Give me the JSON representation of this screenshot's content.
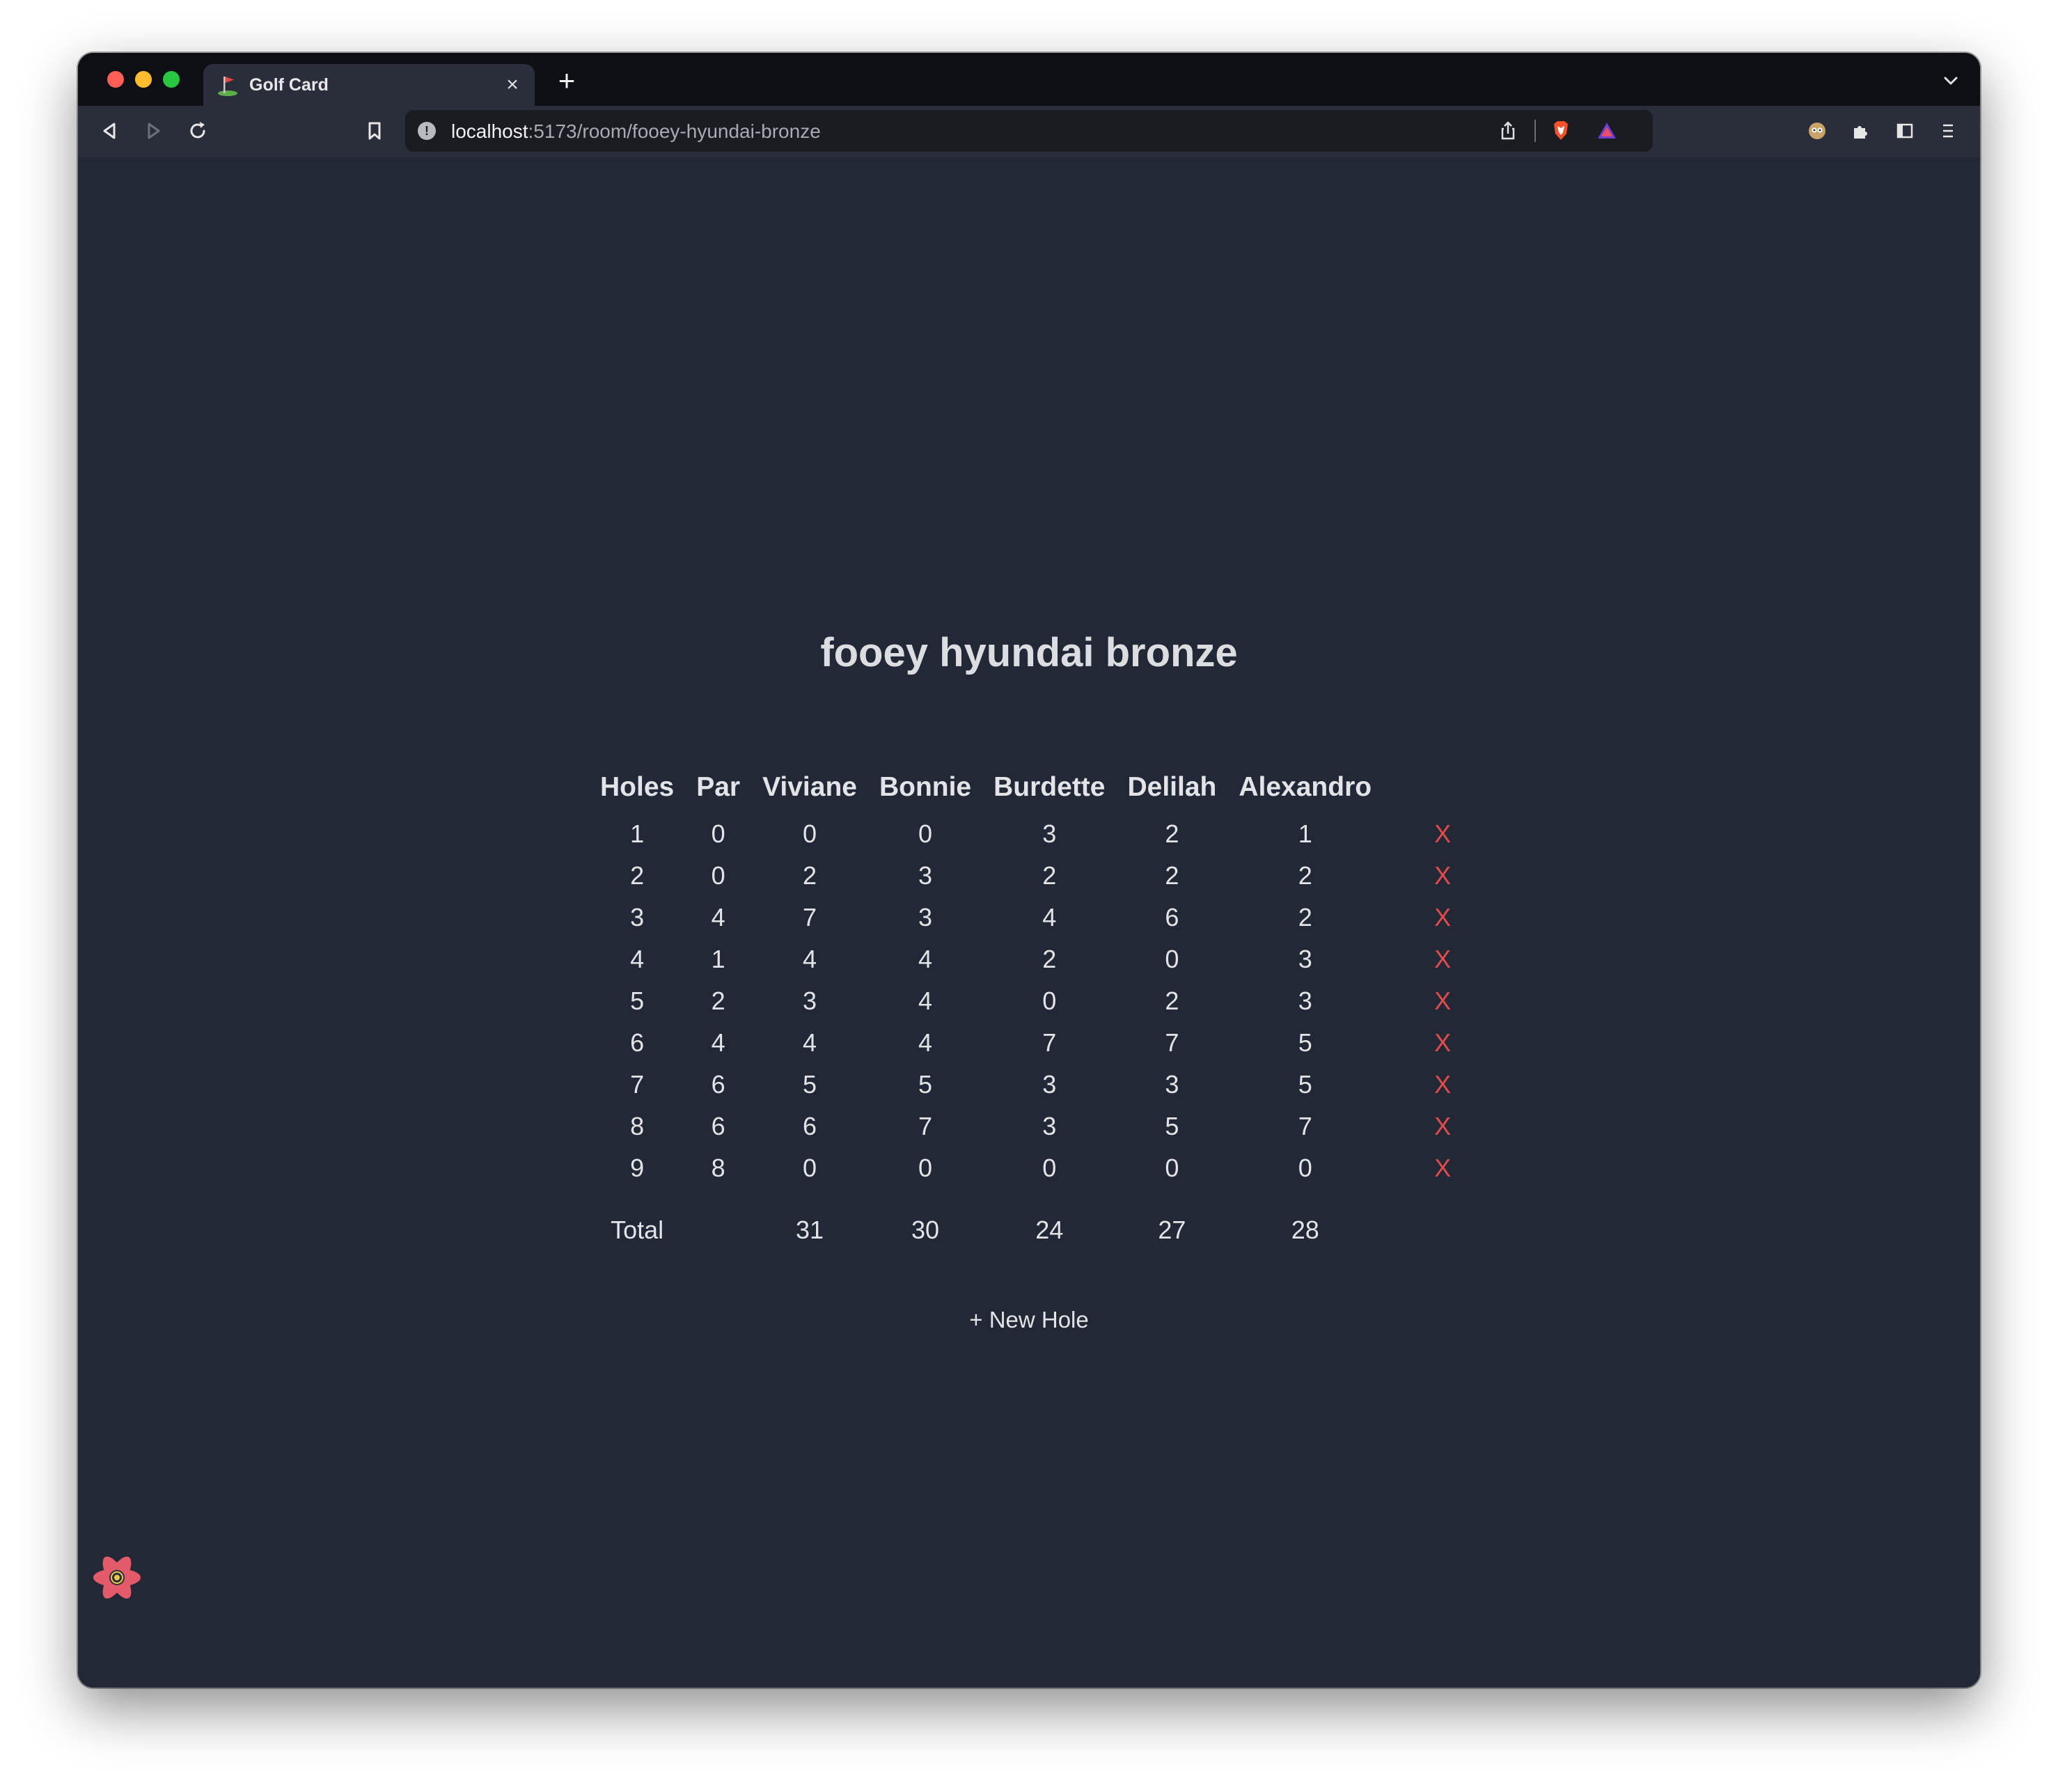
{
  "browser": {
    "tab_title": "Golf Card",
    "tab_close": "×",
    "new_tab": "+",
    "url_host": "localhost",
    "url_rest": ":5173/room/fooey-hyundai-bronze"
  },
  "page": {
    "title": "fooey hyundai bronze",
    "columns": [
      "Holes",
      "Par",
      "Viviane",
      "Bonnie",
      "Burdette",
      "Delilah",
      "Alexandro"
    ],
    "rows": [
      {
        "hole": "1",
        "par": "0",
        "scores": [
          "0",
          "0",
          "3",
          "2",
          "1"
        ]
      },
      {
        "hole": "2",
        "par": "0",
        "scores": [
          "2",
          "3",
          "2",
          "2",
          "2"
        ]
      },
      {
        "hole": "3",
        "par": "4",
        "scores": [
          "7",
          "3",
          "4",
          "6",
          "2"
        ]
      },
      {
        "hole": "4",
        "par": "1",
        "scores": [
          "4",
          "4",
          "2",
          "0",
          "3"
        ]
      },
      {
        "hole": "5",
        "par": "2",
        "scores": [
          "3",
          "4",
          "0",
          "2",
          "3"
        ]
      },
      {
        "hole": "6",
        "par": "4",
        "scores": [
          "4",
          "4",
          "7",
          "7",
          "5"
        ]
      },
      {
        "hole": "7",
        "par": "6",
        "scores": [
          "5",
          "5",
          "3",
          "3",
          "5"
        ]
      },
      {
        "hole": "8",
        "par": "6",
        "scores": [
          "6",
          "7",
          "3",
          "5",
          "7"
        ]
      },
      {
        "hole": "9",
        "par": "8",
        "scores": [
          "0",
          "0",
          "0",
          "0",
          "0"
        ]
      }
    ],
    "delete_label": "X",
    "total_label": "Total",
    "totals": [
      "31",
      "30",
      "24",
      "27",
      "28"
    ],
    "new_hole_label": "+ New Hole"
  },
  "colors": {
    "background": "#222836",
    "delete": "#e04b4b",
    "text": "#e3e4e7"
  }
}
